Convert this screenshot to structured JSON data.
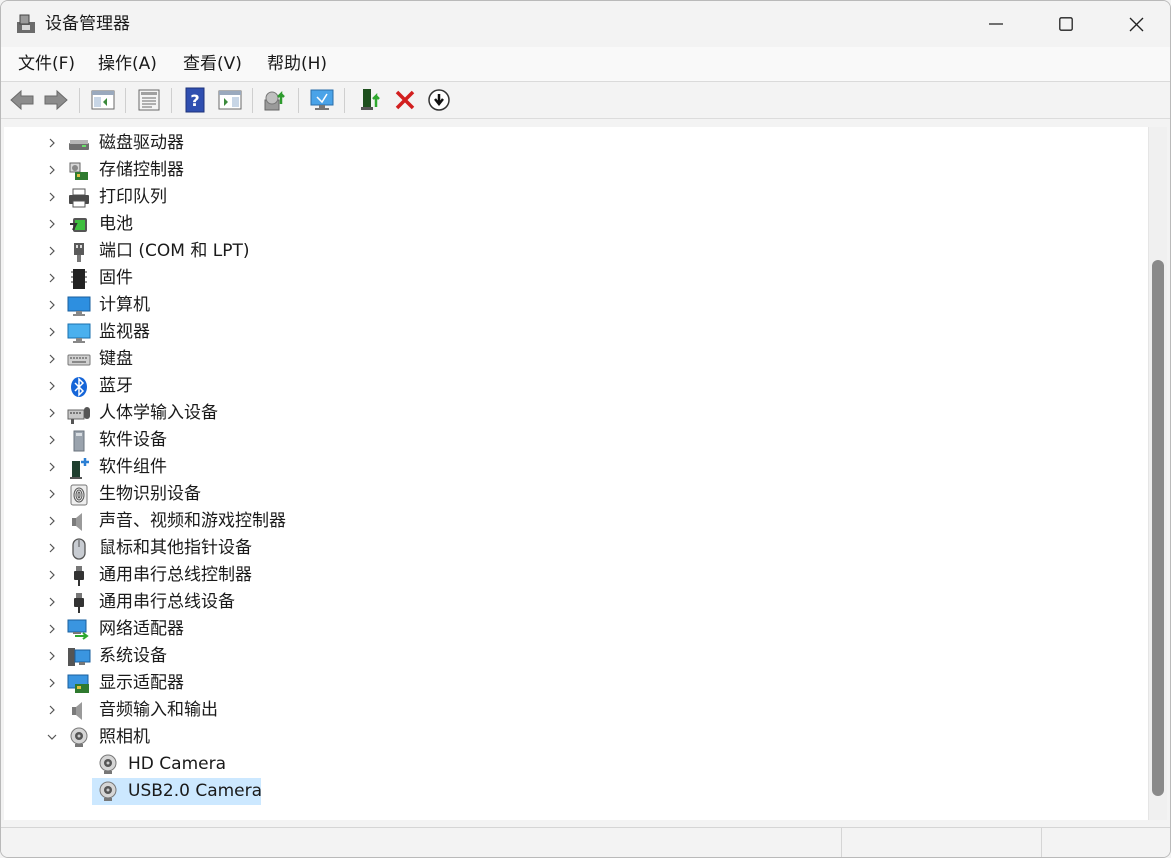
{
  "window": {
    "title": "设备管理器"
  },
  "menu": {
    "items": [
      {
        "label": "文件(F)"
      },
      {
        "label": "操作(A)"
      },
      {
        "label": "查看(V)"
      },
      {
        "label": "帮助(H)"
      }
    ]
  },
  "toolbar": {
    "buttons": [
      {
        "icon": "back-arrow-icon"
      },
      {
        "icon": "forward-arrow-icon"
      },
      {
        "icon": "show-hide-console-tree-icon"
      },
      {
        "icon": "properties-icon"
      },
      {
        "icon": "help-icon"
      },
      {
        "icon": "action-pane-icon"
      },
      {
        "icon": "scan-hardware-changes-icon"
      },
      {
        "icon": "monitor-icon"
      },
      {
        "icon": "update-driver-icon"
      },
      {
        "icon": "uninstall-device-icon"
      },
      {
        "icon": "disable-device-icon"
      }
    ]
  },
  "tree": {
    "categories": [
      {
        "label": "磁盘驱动器",
        "icon": "disk-drive-icon",
        "expanded": false
      },
      {
        "label": "存储控制器",
        "icon": "storage-controller-icon",
        "expanded": false
      },
      {
        "label": "打印队列",
        "icon": "printer-icon",
        "expanded": false
      },
      {
        "label": "电池",
        "icon": "battery-icon",
        "expanded": false
      },
      {
        "label": "端口 (COM 和 LPT)",
        "icon": "port-icon",
        "expanded": false
      },
      {
        "label": "固件",
        "icon": "firmware-icon",
        "expanded": false
      },
      {
        "label": "计算机",
        "icon": "computer-icon",
        "expanded": false
      },
      {
        "label": "监视器",
        "icon": "monitor-icon",
        "expanded": false
      },
      {
        "label": "键盘",
        "icon": "keyboard-icon",
        "expanded": false
      },
      {
        "label": "蓝牙",
        "icon": "bluetooth-icon",
        "expanded": false
      },
      {
        "label": "人体学输入设备",
        "icon": "hid-icon",
        "expanded": false
      },
      {
        "label": "软件设备",
        "icon": "software-device-icon",
        "expanded": false
      },
      {
        "label": "软件组件",
        "icon": "software-component-icon",
        "expanded": false
      },
      {
        "label": "生物识别设备",
        "icon": "fingerprint-icon",
        "expanded": false
      },
      {
        "label": "声音、视频和游戏控制器",
        "icon": "speaker-icon",
        "expanded": false
      },
      {
        "label": "鼠标和其他指针设备",
        "icon": "mouse-icon",
        "expanded": false
      },
      {
        "label": "通用串行总线控制器",
        "icon": "usb-icon",
        "expanded": false
      },
      {
        "label": "通用串行总线设备",
        "icon": "usb-icon",
        "expanded": false
      },
      {
        "label": "网络适配器",
        "icon": "network-adapter-icon",
        "expanded": false
      },
      {
        "label": "系统设备",
        "icon": "system-device-icon",
        "expanded": false
      },
      {
        "label": "显示适配器",
        "icon": "display-adapter-icon",
        "expanded": false
      },
      {
        "label": "音频输入和输出",
        "icon": "audio-io-icon",
        "expanded": false
      },
      {
        "label": "照相机",
        "icon": "camera-icon",
        "expanded": true
      }
    ],
    "camera_children": [
      {
        "label": "HD Camera",
        "icon": "webcam-icon",
        "selected": false
      },
      {
        "label": "USB2.0 Camera",
        "icon": "webcam-icon",
        "selected": true
      }
    ]
  },
  "colors": {
    "selection": "#cce8ff",
    "accent_blue": "#0a64c8",
    "delete_red": "#d21f1f"
  }
}
